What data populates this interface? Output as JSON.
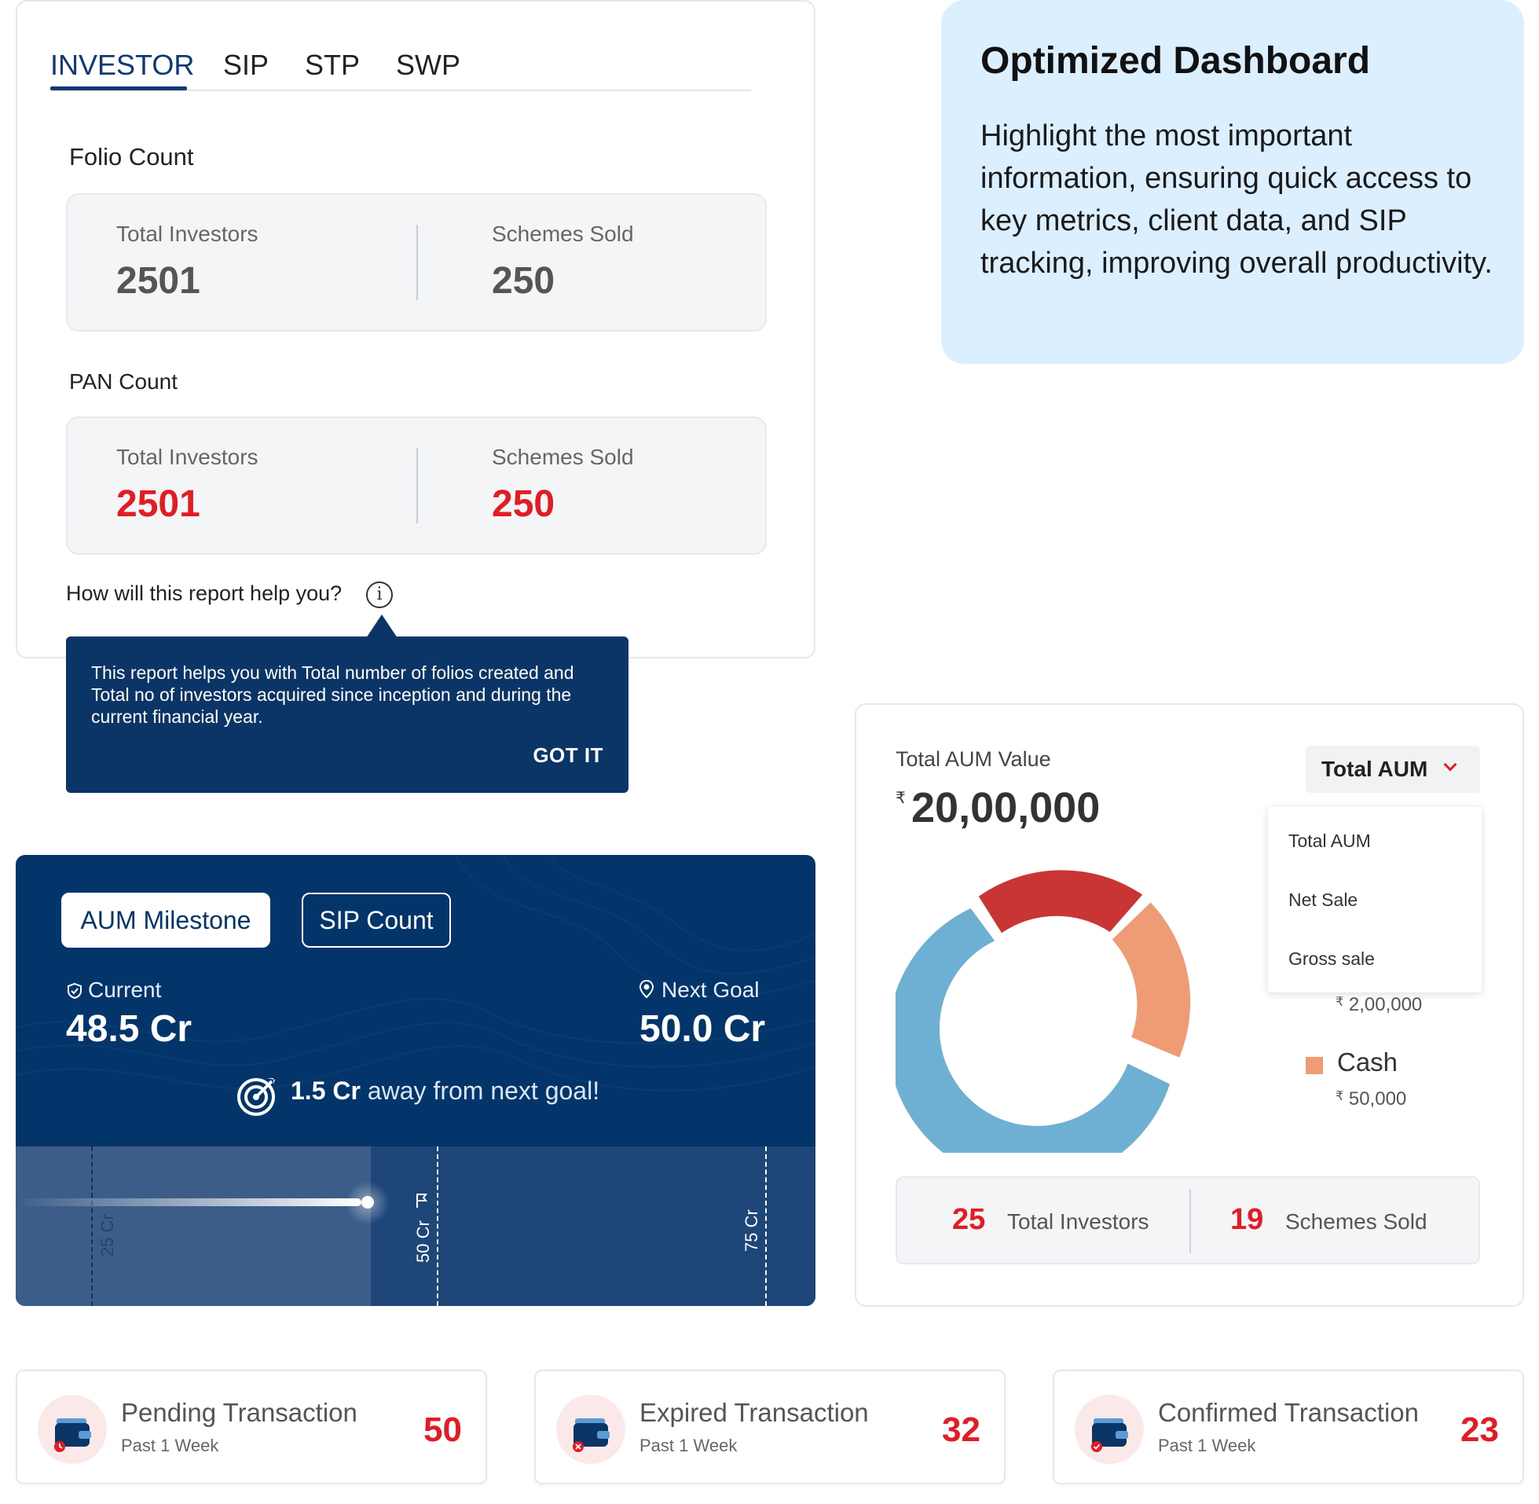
{
  "investor_card": {
    "tabs": [
      "INVESTOR",
      "SIP",
      "STP",
      "SWP"
    ],
    "active_tab": "INVESTOR",
    "folio": {
      "heading": "Folio Count",
      "total_investors_label": "Total Investors",
      "total_investors_value": "2501",
      "schemes_sold_label": "Schemes Sold",
      "schemes_sold_value": "250"
    },
    "pan": {
      "heading": "PAN Count",
      "total_investors_label": "Total Investors",
      "total_investors_value": "2501",
      "schemes_sold_label": "Schemes Sold",
      "schemes_sold_value": "250"
    },
    "help_question": "How will this report help you?",
    "info_icon": "i",
    "tooltip": {
      "text": "This report helps you with Total number of folios created and Total no of investors acquired since inception and during the current financial year.",
      "action": "GOT IT"
    }
  },
  "optimized_panel": {
    "title": "Optimized Dashboard",
    "body": "Highlight the most important information, ensuring quick access to key metrics, client data, and SIP tracking, improving overall productivity."
  },
  "milestone": {
    "tabs": [
      "AUM Milestone",
      "SIP Count"
    ],
    "active_tab": "AUM Milestone",
    "current_label": "Current",
    "current_value": "48.5 Cr",
    "next_goal_label": "Next Goal",
    "next_goal_value": "50.0 Cr",
    "away_value": "1.5 Cr",
    "away_text": "away from next goal!",
    "track_labels": [
      "25 Cr",
      "50 Cr",
      "75 Cr"
    ],
    "progress_fraction": 0.97
  },
  "aum_card": {
    "label": "Total AUM Value",
    "currency": "₹",
    "value": "20,00,000",
    "dropdown": {
      "selected": "Total AUM",
      "options": [
        "Total AUM",
        "Net Sale",
        "Gross sale"
      ]
    },
    "legend": [
      {
        "name": "",
        "value": "2,00,000"
      },
      {
        "name": "Cash",
        "value": "50,000",
        "color": "#ee9b76"
      }
    ],
    "bottom": {
      "total_investors_value": "25",
      "total_investors_label": "Total Investors",
      "schemes_sold_value": "19",
      "schemes_sold_label": "Schemes Sold"
    }
  },
  "transactions": [
    {
      "title": "Pending Transaction",
      "sub": "Past 1 Week",
      "count": "50",
      "icon": "wallet-pending-icon"
    },
    {
      "title": "Expired Transaction",
      "sub": "Past 1 Week",
      "count": "32",
      "icon": "wallet-expired-icon"
    },
    {
      "title": "Confirmed Transaction",
      "sub": "Past 1 Week",
      "count": "23",
      "icon": "wallet-confirmed-icon"
    }
  ],
  "colors": {
    "navy": "#03356a",
    "accent_red": "#e31b23",
    "panel_blue": "#dcefff",
    "donut_blue": "#6eafd4",
    "donut_red": "#c93535",
    "donut_orange": "#ee9b76"
  }
}
